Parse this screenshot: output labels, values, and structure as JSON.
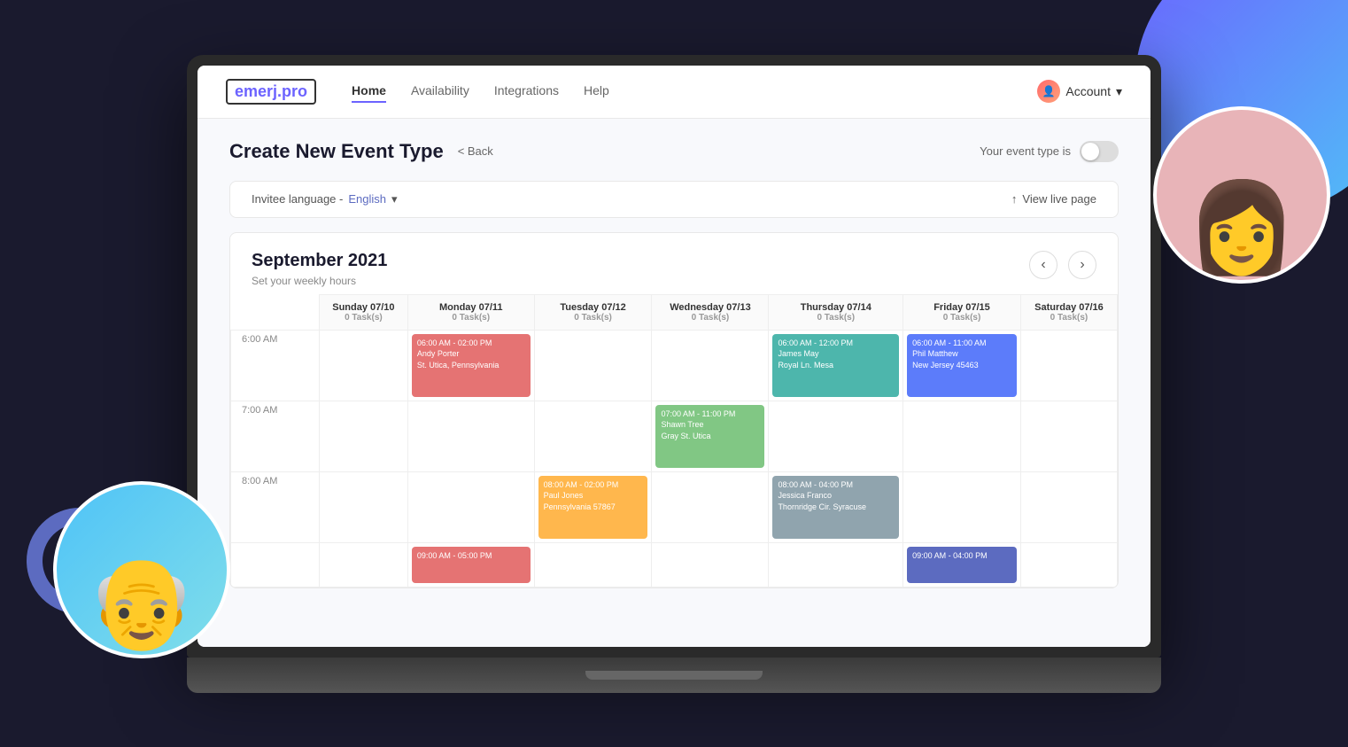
{
  "background": {
    "color": "#1a1a2e"
  },
  "nav": {
    "logo": "emerj.pro",
    "items": [
      {
        "label": "Home",
        "active": true
      },
      {
        "label": "Availability",
        "active": false
      },
      {
        "label": "Integrations",
        "active": false
      },
      {
        "label": "Help",
        "active": false
      }
    ],
    "account_label": "Account"
  },
  "page": {
    "title": "Create New Event Type",
    "back_label": "< Back",
    "toggle_label": "Your event type is",
    "language_label": "Invitee language - ",
    "language_value": "English",
    "view_live_label": "View live page"
  },
  "calendar": {
    "month": "September 2021",
    "subtitle": "Set your weekly hours",
    "days": [
      {
        "name": "Sunday 07/10",
        "tasks": "0 Task(s)"
      },
      {
        "name": "Monday 07/11",
        "tasks": "0 Task(s)"
      },
      {
        "name": "Tuesday 07/12",
        "tasks": "0 Task(s)"
      },
      {
        "name": "Wednesday 07/13",
        "tasks": "0 Task(s)"
      },
      {
        "name": "Thursday 07/14",
        "tasks": "0 Task(s)"
      },
      {
        "name": "Friday 07/15",
        "tasks": "0 Task(s)"
      },
      {
        "name": "Saturday 07/16",
        "tasks": "0 Task(s)"
      }
    ],
    "time_slots": [
      "6:00 AM",
      "7:00 AM",
      "8:00 AM"
    ],
    "events": {
      "row0": {
        "monday": {
          "color": "event-red",
          "time": "06:00 AM - 02:00 PM",
          "name": "Andy Porter",
          "location": "St. Utica, Pennsylvania"
        },
        "thursday": {
          "color": "event-teal",
          "time": "06:00 AM - 12:00 PM",
          "name": "James May",
          "location": "Royal Ln. Mesa"
        },
        "friday": {
          "color": "event-blue",
          "time": "06:00 AM - 11:00 AM",
          "name": "Phil Matthew",
          "location": "New Jersey 45463"
        }
      },
      "row1": {
        "wednesday": {
          "color": "event-green",
          "time": "07:00 AM - 11:00 PM",
          "name": "Shawn Tree",
          "location": "Gray St. Utica"
        }
      },
      "row2": {
        "tuesday": {
          "color": "event-orange",
          "time": "08:00 AM - 02:00 PM",
          "name": "Paul Jones",
          "location": "Pennsylvania 57867"
        },
        "thursday": {
          "color": "event-gray",
          "time": "08:00 AM - 04:00 PM",
          "name": "Jessica Franco",
          "location": "Thornridge Cir. Syracuse"
        },
        "friday_row3": {
          "color": "event-darkblue",
          "time": "09:00 AM - 04:00 PM",
          "name": "",
          "location": ""
        },
        "monday_row3": {
          "color": "event-red",
          "time": "09:00 AM - 05:00 PM",
          "name": "",
          "location": ""
        }
      }
    }
  }
}
